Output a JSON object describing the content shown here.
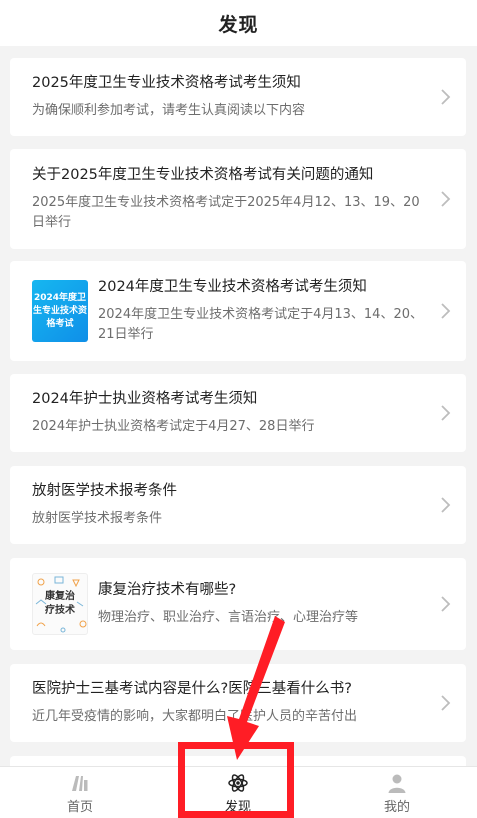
{
  "header": {
    "title": "发现"
  },
  "articles": [
    {
      "title": "2025年度卫生专业技术资格考试考生须知",
      "desc": "为确保顺利参加考试，请考生认真阅读以下内容"
    },
    {
      "title": "关于2025年度卫生专业技术资格考试有关问题的通知",
      "desc": "2025年度卫生专业技术资格考试定于2025年4月12、13、19、20日举行"
    },
    {
      "title": "2024年度卫生专业技术资格考试考生须知",
      "desc": "2024年度卫生专业技术资格考试定于4月13、14、20、21日举行",
      "thumb_text": "2024年度卫生专业技术资格考试"
    },
    {
      "title": "2024年护士执业资格考试考生须知",
      "desc": "2024年护士执业资格考试定于4月27、28日举行"
    },
    {
      "title": "放射医学技术报考条件",
      "desc": "放射医学技术报考条件"
    },
    {
      "title": "康复治疗技术有哪些?",
      "desc": "物理治疗、职业治疗、言语治疗、心理治疗等",
      "thumb_text": "康复治疗技术"
    },
    {
      "title": "医院护士三基考试内容是什么?医院三基看什么书?",
      "desc": "近几年受疫情的影响，大家都明白了医护人员的辛苦付出"
    }
  ],
  "tabbar": {
    "home": {
      "label": "首页",
      "icon": "home-icon"
    },
    "discover": {
      "label": "发现",
      "icon": "atom-icon"
    },
    "mine": {
      "label": "我的",
      "icon": "user-icon"
    }
  },
  "colors": {
    "highlight": "#ff1d25",
    "thumb_blue": "#16b7f0"
  }
}
